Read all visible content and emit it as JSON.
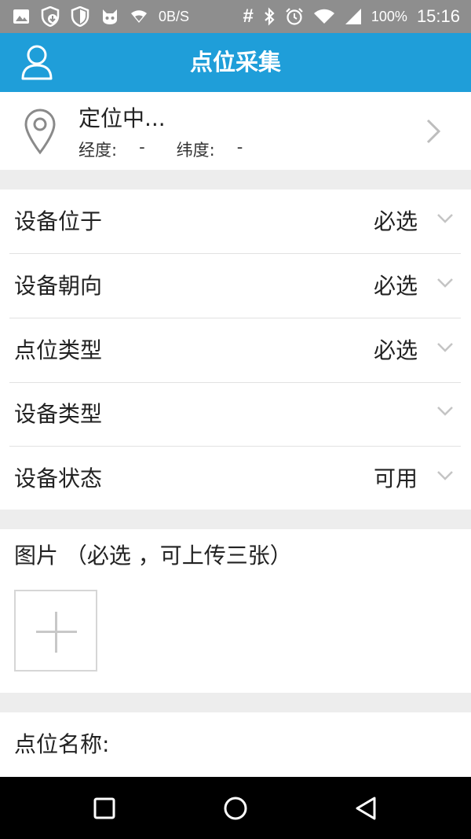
{
  "status_bar": {
    "net_speed": "0B/S",
    "battery": "100%",
    "time": "15:16",
    "hash_symbol": "#",
    "icons": [
      "image-icon",
      "shield-download-icon",
      "shield-icon",
      "cat-icon",
      "wifi-icon",
      "bluetooth-icon",
      "alarm-icon",
      "wifi-full-icon",
      "signal-icon"
    ]
  },
  "app_bar": {
    "title": "点位采集",
    "accent_color": "#1f9ed9"
  },
  "location": {
    "title": "定位中...",
    "lng_label": "经度:",
    "lng_value": "-",
    "lat_label": "纬度:",
    "lat_value": "-"
  },
  "fields": [
    {
      "label": "设备位于",
      "value": "必选"
    },
    {
      "label": "设备朝向",
      "value": "必选"
    },
    {
      "label": "点位类型",
      "value": "必选"
    },
    {
      "label": "设备类型",
      "value": ""
    },
    {
      "label": "设备状态",
      "value": "可用"
    }
  ],
  "photos": {
    "title": "图片 （必选 ，可上传三张）"
  },
  "point_name": {
    "label": "点位名称:"
  },
  "nav_bar": {
    "icons": [
      "recents-icon",
      "home-icon",
      "back-icon"
    ]
  }
}
